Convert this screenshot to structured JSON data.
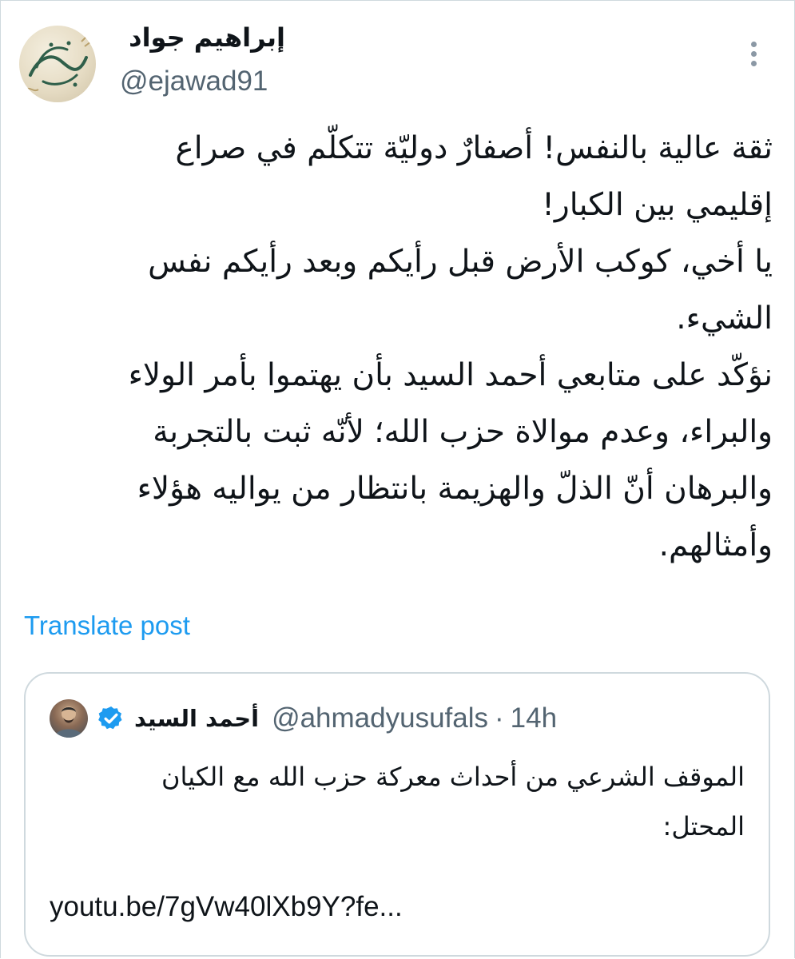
{
  "post": {
    "author_name": "إبراهيم جواد",
    "author_handle": "@ejawad91",
    "avatar_text": "يا حي يا قيوم",
    "body_lines": [
      "ثقة عالية بالنفس! أصفارٌ دوليّة تتكلّم في صراع",
      "إقليمي بين الكبار!",
      "يا أخي، كوكب الأرض قبل رأيكم وبعد رأيكم نفس",
      "الشيء.",
      "نؤكّد على متابعي أحمد السيد بأن يهتموا بأمر الولاء",
      "والبراء، وعدم موالاة حزب الله؛ لأنّه ثبت بالتجربة",
      "والبرهان أنّ الذلّ والهزيمة بانتظار من يواليه هؤلاء",
      "وأمثالهم."
    ],
    "translate_label": "Translate post"
  },
  "quote": {
    "author_name": "أحمد السيد",
    "author_handle": "@ahmadyusufals",
    "separator": "·",
    "time": "14h",
    "body_lines": [
      "الموقف الشرعي من أحداث معركة حزب الله مع الكيان",
      "المحتل:"
    ],
    "link": "youtu.be/7gVw40lXb9Y?fe..."
  },
  "colors": {
    "accent": "#1d9bf0",
    "text": "#0f1419",
    "secondary": "#536471",
    "border": "#cfd9de"
  },
  "icons": [
    "more-vertical-icon",
    "verified-badge-icon"
  ]
}
